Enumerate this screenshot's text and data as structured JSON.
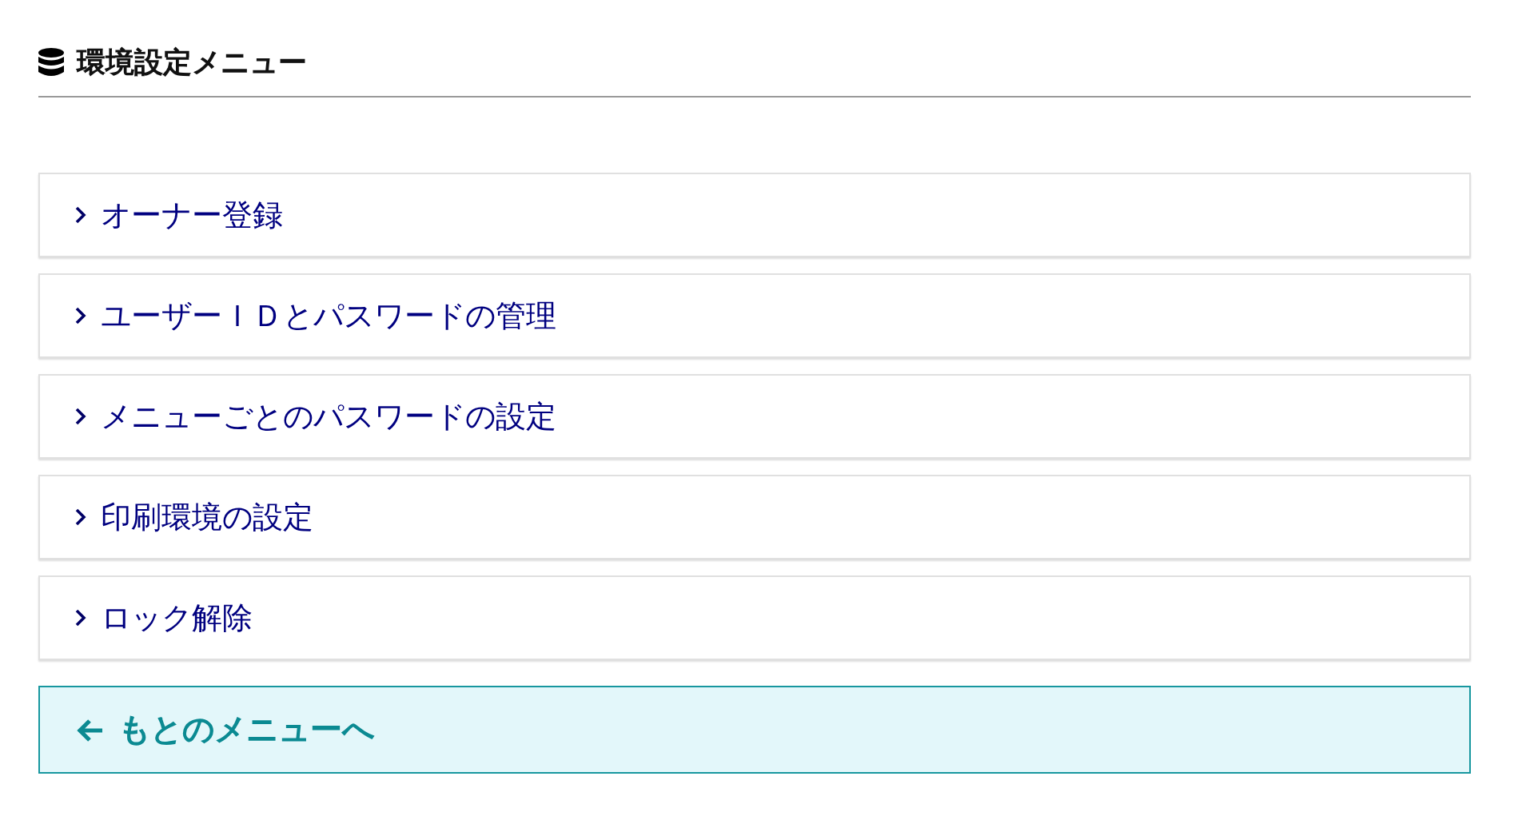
{
  "header": {
    "title": "環境設定メニュー"
  },
  "menu_items": [
    {
      "label": "オーナー登録"
    },
    {
      "label": "ユーザーＩＤとパスワードの管理"
    },
    {
      "label": "メニューごとのパスワードの設定"
    },
    {
      "label": "印刷環境の設定"
    },
    {
      "label": "ロック解除"
    }
  ],
  "back_button": {
    "label": "もとのメニューへ"
  }
}
